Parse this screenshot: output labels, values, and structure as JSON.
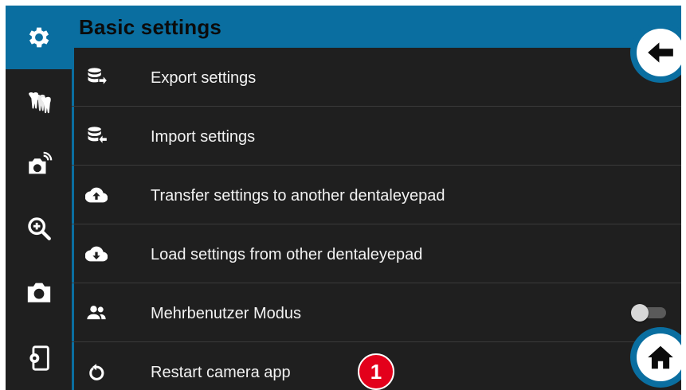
{
  "header": {
    "title": "Basic settings"
  },
  "rail": {
    "items": [
      {
        "icon": "gear-icon",
        "active": true
      },
      {
        "icon": "teeth-icon",
        "active": false
      },
      {
        "icon": "camera-wireless-icon",
        "active": false
      },
      {
        "icon": "zoom-in-icon",
        "active": false
      },
      {
        "icon": "camera-icon",
        "active": false
      },
      {
        "icon": "device-settings-icon",
        "active": false
      }
    ]
  },
  "list": {
    "items": [
      {
        "label": "Export settings",
        "icon": "database-export-icon"
      },
      {
        "label": "Import settings",
        "icon": "database-import-icon"
      },
      {
        "label": "Transfer settings to another dentaleyepad",
        "icon": "cloud-upload-icon"
      },
      {
        "label": "Load settings from other dentaleyepad",
        "icon": "cloud-download-icon"
      },
      {
        "label": "Mehrbenutzer Modus",
        "icon": "users-icon",
        "toggle": false
      },
      {
        "label": "Restart camera app",
        "icon": "restart-icon"
      }
    ]
  },
  "buttons": {
    "back_icon": "arrow-left-icon",
    "home_icon": "home-icon"
  },
  "annotation": {
    "label": "1"
  },
  "colors": {
    "accent": "#0a6ea0",
    "background": "#1f1f1f",
    "badge": "#e3001b"
  }
}
